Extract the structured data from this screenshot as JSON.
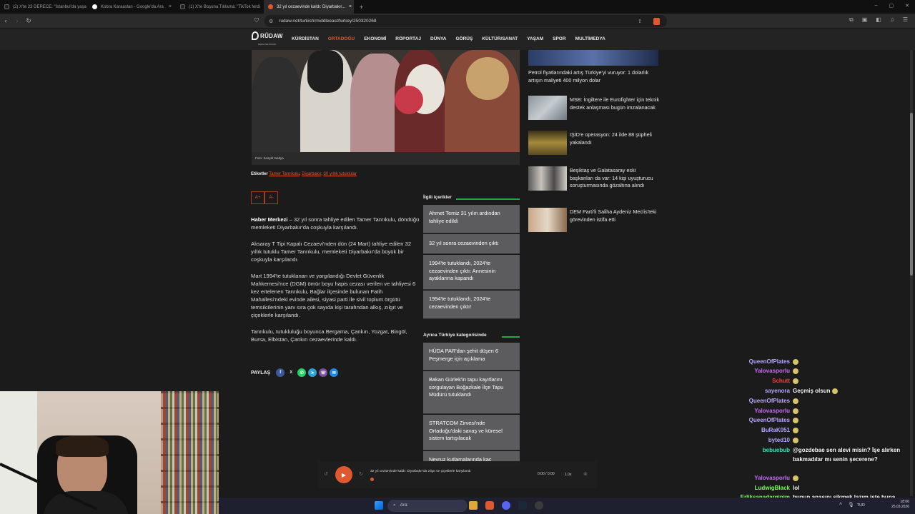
{
  "browser": {
    "tabs": [
      {
        "title": "(2) X'te 23 DERECE: \"İstanbul'da yaşa"
      },
      {
        "title": "Kobra Karaaslan - Google'da Ara"
      },
      {
        "title": "(1) X'te Boşuna Tıklama: \"TikTok ferdi"
      },
      {
        "title": "32 yıl cezaevinde kaldı: Diyarbakır..."
      }
    ],
    "url": "rudaw.net/turkish/middleeast/turkey/250320268"
  },
  "site": {
    "logo": "RÛDAW",
    "logo_sub": "MEDIA NETWORK",
    "menu": [
      "KÜRDİSTAN",
      "ORTADOĞU",
      "EKONOMİ",
      "RÖPORTAJ",
      "DÜNYA",
      "GÖRÜŞ",
      "KÜLTÜR/SANAT",
      "YAŞAM",
      "SPOR",
      "MULTİMEDYA"
    ]
  },
  "article": {
    "photo_caption": "Foto: Sosyal medya",
    "tags_label": "Etiketler",
    "tags": [
      "Tamer Tanrıkulu",
      "Diyarbakır",
      "30 yıllık tutuklular"
    ],
    "font_up": "A+",
    "font_down": "A-",
    "lead_bold": "Haber Merkezi",
    "lead_rest": " – 32 yıl sonra tahliye edilen Tamer Tanrıkulu, döndüğü memleketi Diyarbakır'da coşkuyla karşılandı.",
    "p2": "Aksaray T Tipi Kapalı Cezaevi'nden dün (24 Mart) tahliye edilen 32 yıllık tutuklu Tamer Tanrıkulu, memleketi Diyarbakır'da büyük bir coşkuyla karşılandı.",
    "p3": "Mart 1994'te tutuklanan ve yargılandığı Devlet Güvenlik Mahkemesi'nce (DGM) ömür boyu hapis cezası verilen ve tahliyesi 6 kez ertelenen Tanrıkulu, Bağlar ilçesinde bulunan Fatih Mahallesi'ndeki evinde ailesi, siyasi parti ile sivil toplum örgütü temsilcilerinin yanı sıra çok sayıda kişi tarafından alkış, zılgıt ve çiçeklerle karşılandı.",
    "p4": "Tanrıkulu, tutukluluğu boyunca Bergama, Çankırı, Yozgat, Bingöl, Bursa, Elbistan, Çankırı cezaevlerinde kaldı.",
    "share_label": "PAYLAŞ"
  },
  "related": {
    "heading": "İlgili içerikler",
    "items": [
      "Ahmet Temiz 31 yılın ardından tahliye edildi",
      "32 yıl sonra cezaevinden çıktı",
      "1994'te tutuklandı, 2024'te cezaevinden çıktı: Annesinin ayaklarına kapandı",
      "1994'te tutuklandı, 2024'te cezaevinden çıktı!"
    ],
    "heading2": "Ayrıca Türkiye kategorisinde",
    "items2": [
      "HÜDA PAR'dan şehit düşen 6 Peşmerge için açıklama",
      "Bakan Gürlek'in tapu kayıtlarını sorgulayan Boğazkale İlçe Tapu Müdürü tutuklandı",
      "STRATCOM Zirvesi'nde Ortadoğu'daki savaş ve küresel sistem tartışılacak",
      "Nevruz kutlamalarında kaç"
    ]
  },
  "sidebar": {
    "top_title": "Petrol fiyatlarındaki artış Türkiye'yi vuruyor: 1 dolarlık artışın maliyeti 400 milyon dolar",
    "items": [
      "MSB: İngiltere ile Eurofighter için teknik destek anlaşması bugün imzalanacak",
      "IŞİD'e operasyon: 24 ilde 88 şüpheli yakalandı",
      "Beşiktaş ve Galatasaray eski başkanları da var: 14 kişi uyuşturucu soruşturmasında gözaltına alındı",
      "DEM Parti'li Saliha Aydeniz Meclis'teki görevinden istifa etti"
    ]
  },
  "player": {
    "title": "32 yıl cezaevinde kaldı: Diyarbakır'da zılgıt ve çiçeklerle karşılandı",
    "time": "0:00 / 0:00",
    "speed": "1.0x"
  },
  "chat": [
    {
      "user": "QueenOfPlates",
      "msg": "",
      "color": "#b9a6ff"
    },
    {
      "user": "Yalovasporlu",
      "msg": "",
      "color": "#c86bff"
    },
    {
      "user": "Schutt",
      "msg": "",
      "color": "#ff3b3b"
    },
    {
      "user": "sayenora",
      "msg": "Geçmiş olsun",
      "color": "#b9a6ff"
    },
    {
      "user": "QueenOfPlates",
      "msg": "",
      "color": "#b9a6ff"
    },
    {
      "user": "Yalovasporlu",
      "msg": "",
      "color": "#c86bff"
    },
    {
      "user": "QueenOfPlates",
      "msg": "",
      "color": "#b9a6ff"
    },
    {
      "user": "BuRaK051",
      "msg": "",
      "color": "#b9a6ff"
    },
    {
      "user": "byted10",
      "msg": "",
      "color": "#b9a6ff"
    },
    {
      "user": "bebuebub",
      "msg": "@gozdebae sen alevi misin? İşe alırken bakmadılar mı senin şecerene?",
      "color": "#2ee6c0"
    },
    {
      "user": "Yalovasporlu",
      "msg": "",
      "color": "#c86bff"
    },
    {
      "user": "LudwigBlack",
      "msg": "lol",
      "color": "#7cff5a"
    },
    {
      "user": "Erliksanadarginim",
      "msg": "bunun anasını sikmek lazım işte buna acıma yok",
      "color": "#7cff5a"
    }
  ],
  "taskbar": {
    "search": "Ara",
    "lang": "TUR",
    "time": "18:06",
    "date": "25.03.2026"
  }
}
